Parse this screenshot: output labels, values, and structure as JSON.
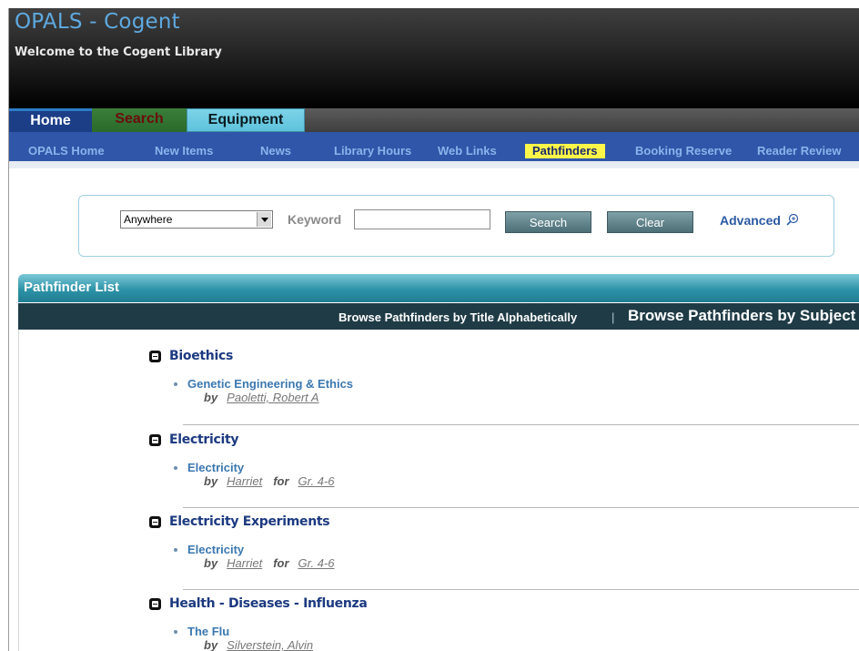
{
  "header": {
    "app_title": "OPALS - Cogent",
    "welcome": "Welcome to the Cogent Library"
  },
  "tabs": [
    {
      "label": "Home",
      "active": true
    },
    {
      "label": "Search"
    },
    {
      "label": "Equipment"
    }
  ],
  "subnav": [
    {
      "label": "OPALS Home"
    },
    {
      "label": "New Items"
    },
    {
      "label": "News"
    },
    {
      "label": "Library Hours"
    },
    {
      "label": "Web Links"
    },
    {
      "label": "Pathfinders",
      "active": true
    },
    {
      "label": "Booking Reserve"
    },
    {
      "label": "Reader Review"
    }
  ],
  "search": {
    "scope_value": "Anywhere",
    "keyword_label": "Keyword",
    "keyword_value": "",
    "search_button": "Search",
    "clear_button": "Clear",
    "advanced_label": "Advanced"
  },
  "pathfinder": {
    "panel_title": "Pathfinder List",
    "browse_alpha": "Browse Pathfinders by Title Alphabetically",
    "browse_sep": "|",
    "browse_subject": "Browse Pathfinders by Subject",
    "by_label": "by",
    "for_label": "for",
    "groups": [
      {
        "subject": "Bioethics",
        "items": [
          {
            "title": "Genetic Engineering & Ethics",
            "author": "Paoletti, Robert A",
            "grade": ""
          }
        ]
      },
      {
        "subject": "Electricity",
        "items": [
          {
            "title": "Electricity",
            "author": "Harriet",
            "grade": "Gr. 4-6"
          }
        ]
      },
      {
        "subject": "Electricity Experiments",
        "items": [
          {
            "title": "Electricity",
            "author": "Harriet",
            "grade": "Gr. 4-6"
          }
        ]
      },
      {
        "subject": "Health - Diseases - Influenza",
        "items": [
          {
            "title": "The Flu",
            "author": "Silverstein, Alvin",
            "grade": ""
          }
        ]
      }
    ]
  },
  "colors": {
    "title_blue": "#5ea9e0",
    "subnav_blue": "#2f56a8",
    "active_highlight": "#fff64a",
    "panel_teal": "#2e93a8",
    "browse_bar": "#1f3c46",
    "subject_title": "#1c3a80",
    "item_title": "#3b78b0"
  },
  "icons": [
    "magnifier-plus-icon",
    "collapse-icon",
    "bullet-icon",
    "dropdown-arrow-icon"
  ]
}
